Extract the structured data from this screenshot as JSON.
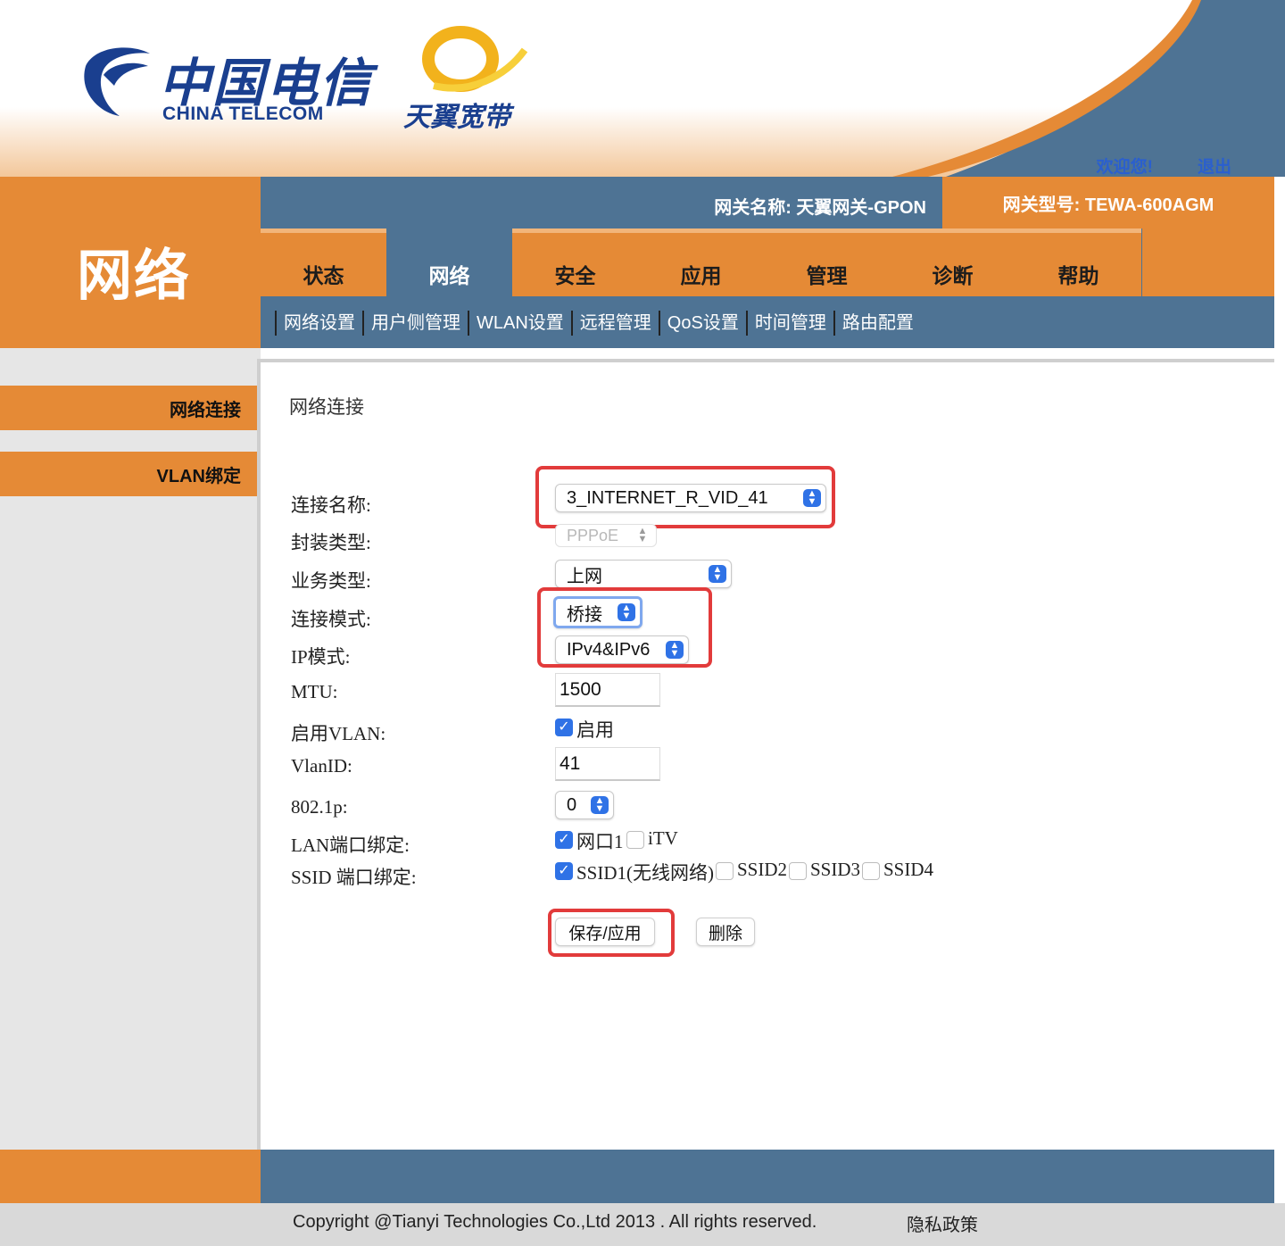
{
  "header": {
    "logo_cn": "中国电信",
    "logo_en": "CHINA TELECOM",
    "logo2_text": "天翼宽带",
    "welcome": "欢迎您!",
    "logout": "退出",
    "gateway_name": "网关名称:  天翼网关-GPON",
    "gateway_model": "网关型号:  TEWA-600AGM"
  },
  "brand_title": "网络",
  "tabs": [
    "状态",
    "网络",
    "安全",
    "应用",
    "管理",
    "诊断",
    "帮助"
  ],
  "active_tab": "网络",
  "subnav": [
    "网络设置",
    "用户侧管理",
    "WLAN设置",
    "远程管理",
    "QoS设置",
    "时间管理",
    "路由配置"
  ],
  "sidebar": [
    "网络连接",
    "VLAN绑定"
  ],
  "form": {
    "title": "网络连接",
    "labels": {
      "connection_name": "连接名称:",
      "encap_type": "封装类型:",
      "service_type": "业务类型:",
      "connection_mode": "连接模式:",
      "ip_mode": "IP模式:",
      "mtu": "MTU:",
      "enable_vlan": "启用VLAN:",
      "vlan_id": "VlanID:",
      "dot1p": "802.1p:",
      "lan_bind": "LAN端口绑定:",
      "ssid_bind": "SSID 端口绑定:"
    },
    "values": {
      "connection_name": "3_INTERNET_R_VID_41",
      "encap_type": "PPPoE",
      "service_type": "上网",
      "connection_mode": "桥接",
      "ip_mode": "IPv4&IPv6",
      "mtu": "1500",
      "vlan_enable_label": "启用",
      "vlan_id": "41",
      "dot1p": "0"
    },
    "lan_ports": [
      {
        "label": "网口1",
        "checked": true
      },
      {
        "label": "iTV",
        "checked": false
      }
    ],
    "ssid_ports": [
      {
        "label": "SSID1(无线网络)",
        "checked": true
      },
      {
        "label": "SSID2",
        "checked": false
      },
      {
        "label": "SSID3",
        "checked": false
      },
      {
        "label": "SSID4",
        "checked": false
      }
    ],
    "buttons": {
      "save": "保存/应用",
      "delete": "删除"
    }
  },
  "footer": {
    "copyright": "Copyright @Tianyi Technologies Co.,Ltd 2013 . All rights reserved.",
    "privacy": "隐私政策"
  },
  "colors": {
    "orange": "#e58a36",
    "blue": "#4e7394",
    "highlight_red": "#e23b3b",
    "select_blue": "#2f72e6"
  }
}
